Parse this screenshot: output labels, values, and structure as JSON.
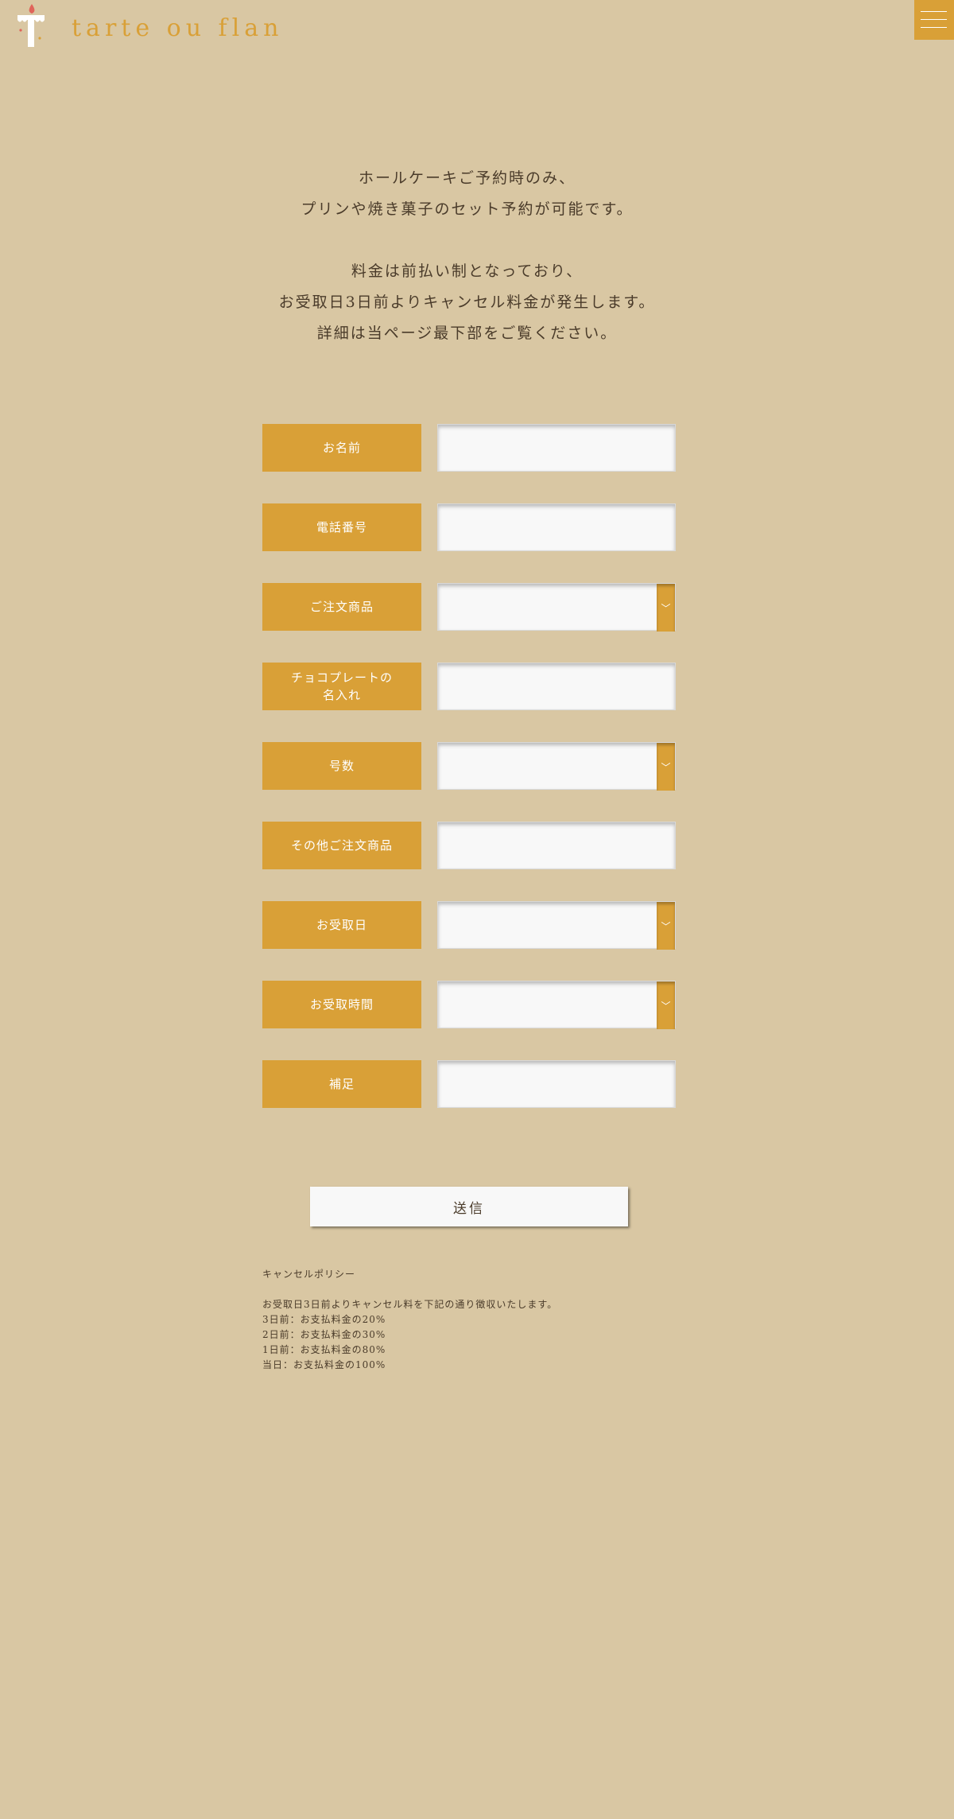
{
  "header": {
    "logo_text": "tarte ou flan",
    "logo_letter": "T",
    "menu_icon": "hamburger-menu-icon"
  },
  "intro": {
    "lines": [
      "ホールケーキご予約時のみ、",
      "プリンや焼き菓子のセット予約が可能です。",
      "料金は前払い制となっており、",
      "お受取日3日前よりキャンセル料金が発生します。",
      "詳細は当ページ最下部をご覧ください。"
    ]
  },
  "form": {
    "fields": [
      {
        "label": "お名前",
        "type": "text",
        "value": ""
      },
      {
        "label": "電話番号",
        "type": "text",
        "value": ""
      },
      {
        "label": "ご注文商品",
        "type": "select",
        "value": ""
      },
      {
        "label": "チョコプレートの",
        "label2": "名入れ",
        "type": "text",
        "value": ""
      },
      {
        "label": "号数",
        "type": "select",
        "value": ""
      },
      {
        "label": "その他ご注文商品",
        "type": "text",
        "value": ""
      },
      {
        "label": "お受取日",
        "type": "select",
        "value": ""
      },
      {
        "label": "お受取時間",
        "type": "select",
        "value": ""
      },
      {
        "label": "補足",
        "type": "text",
        "value": ""
      }
    ],
    "select_arrow": "﹀",
    "submit_label": "送信"
  },
  "policy": {
    "title": "キャンセルポリシー",
    "lines": [
      "お受取日3日前よりキャンセル料を下記の通り徴収いたします。",
      "3日前：お支払料金の20%",
      "2日前：お支払料金の30%",
      "1日前：お支払料金の80%",
      "当日：お支払料金の100%"
    ]
  },
  "colors": {
    "background": "#d9c7a3",
    "accent": "#d9a037",
    "text": "#4a3b2a",
    "field": "#f8f8f8",
    "logo_flame": "#e0645a"
  }
}
